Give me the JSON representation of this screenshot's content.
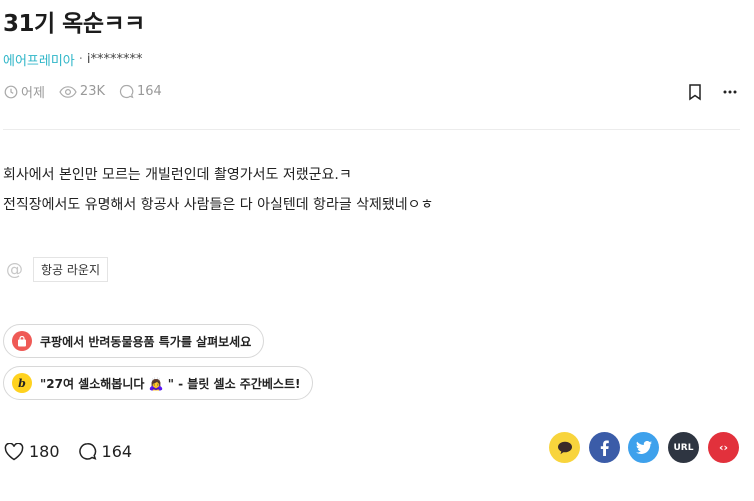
{
  "post": {
    "title": "31기 옥순ㅋㅋ",
    "company": "에어프레미아",
    "separator": "·",
    "author": "i********",
    "time": "어제",
    "views": "23K",
    "comments": "164"
  },
  "body": {
    "lines": [
      "회사에서 본인만 모르는 개빌런인데 촬영가서도 저랬군요.ㅋ",
      "전직장에서도 유명해서 항공사 사람들은 다 아실텐데 항라글 삭제됐네ㅇㅎ"
    ]
  },
  "topic": {
    "at_symbol": "@",
    "label": "항공 라운지"
  },
  "promos": [
    {
      "icon": "shopping-bag-icon",
      "text": "쿠팡에서 반려동물용품 특가를 살펴보세요"
    },
    {
      "icon_text": "b",
      "text": "\"27여 셀소해봅니다 🙇‍♀️ \" - 블릿 셀소 주간베스트!"
    }
  ],
  "actions": {
    "likes": "180",
    "comments": "164"
  },
  "share": {
    "url_label": "URL",
    "embed_label": "‹›"
  },
  "colors": {
    "company": "#2fb6c8",
    "kakao": "#f8d43c",
    "facebook": "#3b5ca8",
    "twitter": "#3ea1ec",
    "url": "#2e3541",
    "embed": "#e2313c"
  }
}
